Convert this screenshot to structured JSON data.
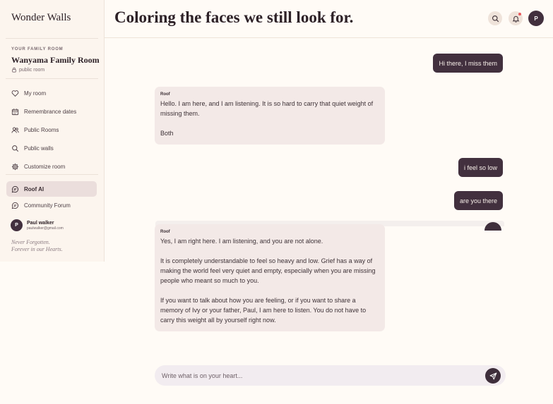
{
  "brand": "Wonder Walls",
  "headline": "Coloring the faces we still look for.",
  "room": {
    "caption": "YOUR FAMILY ROOM",
    "name": "Wanyama Family Room",
    "privacy": "public room"
  },
  "nav": [
    {
      "label": "My room",
      "icon": "heart-icon"
    },
    {
      "label": "Remembrance dates",
      "icon": "calendar-icon"
    },
    {
      "label": "Public Rooms",
      "icon": "users-icon"
    },
    {
      "label": "Public walls",
      "icon": "search-icon"
    },
    {
      "label": "Customize room",
      "icon": "gear-icon"
    },
    {
      "label": "Roof AI",
      "icon": "chat-icon",
      "active": true
    },
    {
      "label": "Community Forum",
      "icon": "chat-icon"
    }
  ],
  "user": {
    "initial": "P",
    "name": "Paul walker",
    "email": "paulwalker@gmail.com"
  },
  "motto": [
    "Never Forgotten.",
    "Forever in our Hearts."
  ],
  "header": {
    "avatar_initial": "P"
  },
  "messages": [
    {
      "role": "user",
      "text": "Hi there, I miss them"
    },
    {
      "role": "assistant",
      "sender": "Roof",
      "paragraphs": [
        "Hello. I am here, and I am listening. It is so hard to carry that quiet weight of missing them.",
        "Both"
      ]
    },
    {
      "role": "user",
      "text": "i feel so low"
    },
    {
      "role": "user",
      "text": "are you there"
    },
    {
      "role": "assistant",
      "sender": "Roof",
      "paragraphs": [
        "Yes, I am right here. I am listening, and you are not alone.",
        "It is completely understandable to feel so heavy and low. Grief has a way of making the world feel very quiet and empty, especially when you are missing people who meant so much to you.",
        "If you want to talk about how you are feeling, or if you want to share a memory of Ivy or your father, Paul, I am here to listen. You do not have to carry this weight all by yourself right now."
      ]
    }
  ],
  "composer": {
    "placeholder": "Write what is on your heart...",
    "value": ""
  },
  "colors": {
    "accent": "#42303e",
    "ai_bubble": "#f3e9e7",
    "background": "#fffbf6",
    "notification": "#e9585c"
  }
}
